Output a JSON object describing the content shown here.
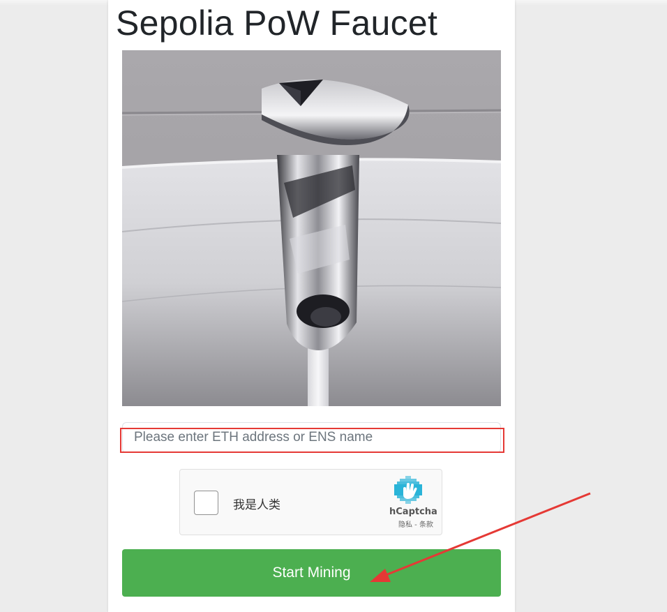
{
  "page": {
    "title": "Sepolia PoW Faucet"
  },
  "form": {
    "address_placeholder": "Please enter ETH address or ENS name",
    "address_value": ""
  },
  "captcha": {
    "checkbox_label": "我是人类",
    "brand": "hCaptcha",
    "privacy_link": "隐私",
    "separator": " - ",
    "terms_link": "条款",
    "checked": false
  },
  "actions": {
    "start_label": "Start Mining"
  },
  "colors": {
    "button": "#4caf50",
    "annotation": "#e53935",
    "captcha_logo": "#2ab4d8"
  },
  "icons": {
    "hero": "faucet-image",
    "captcha": "hcaptcha-logo-icon"
  }
}
